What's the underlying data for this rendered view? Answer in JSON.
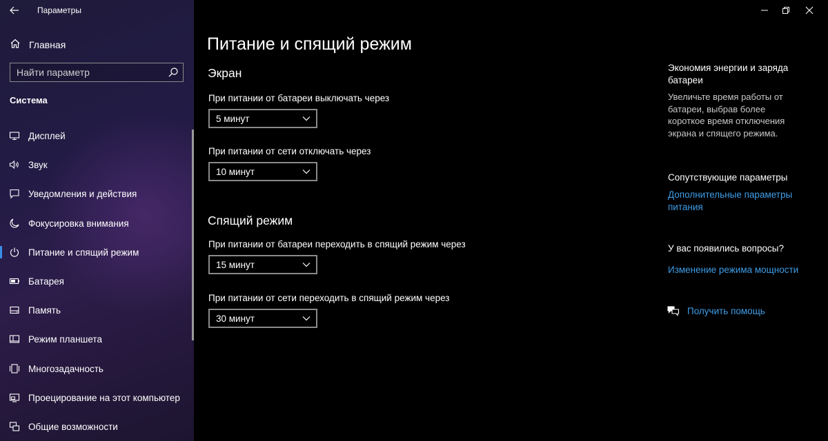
{
  "window": {
    "title": "Параметры"
  },
  "sidebar": {
    "home_label": "Главная",
    "search_placeholder": "Найти параметр",
    "section_title": "Система",
    "items": [
      {
        "label": "Дисплей",
        "icon": "monitor-icon"
      },
      {
        "label": "Звук",
        "icon": "speaker-icon"
      },
      {
        "label": "Уведомления и действия",
        "icon": "notification-icon"
      },
      {
        "label": "Фокусировка внимания",
        "icon": "moon-icon"
      },
      {
        "label": "Питание и спящий режим",
        "icon": "power-icon",
        "active": true
      },
      {
        "label": "Батарея",
        "icon": "battery-icon"
      },
      {
        "label": "Память",
        "icon": "storage-icon"
      },
      {
        "label": "Режим планшета",
        "icon": "tablet-icon"
      },
      {
        "label": "Многозадачность",
        "icon": "multitask-icon"
      },
      {
        "label": "Проецирование на этот компьютер",
        "icon": "project-icon"
      },
      {
        "label": "Общие возможности",
        "icon": "shared-icon"
      }
    ]
  },
  "main": {
    "page_title": "Питание и спящий режим",
    "screen": {
      "title": "Экран",
      "battery_label": "При питании от батареи выключать через",
      "battery_value": "5 минут",
      "plugged_label": "При питании от сети отключать через",
      "plugged_value": "10 минут"
    },
    "sleep": {
      "title": "Спящий режим",
      "battery_label": "При питании от батареи переходить в спящий режим через",
      "battery_value": "15 минут",
      "plugged_label": "При питании от сети переходить в спящий режим через",
      "plugged_value": "30 минут"
    }
  },
  "aside": {
    "tip_title": "Экономия энергии и заряда батареи",
    "tip_text": "Увеличьте время работы от батареи, выбрав более короткое время отключения экрана и спящего режима.",
    "related_title": "Сопутствующие параметры",
    "related_link": "Дополнительные параметры питания",
    "questions_title": "У вас появились вопросы?",
    "questions_link": "Изменение режима мощности",
    "help_link": "Получить помощь"
  },
  "colors": {
    "accent": "#3b8ee8",
    "link": "#3e9de8",
    "background": "#000000"
  }
}
